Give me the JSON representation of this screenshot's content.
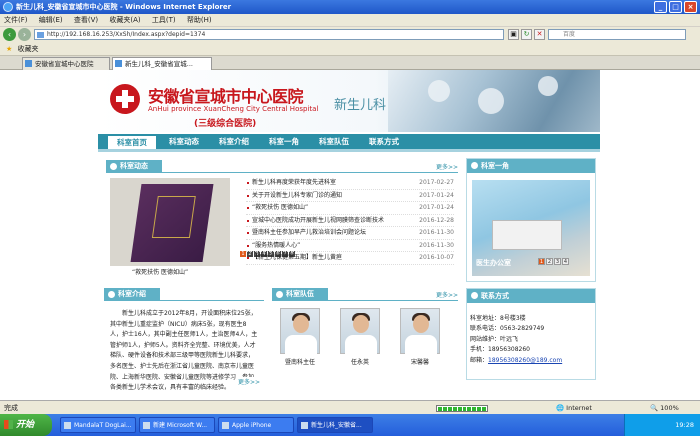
{
  "window": {
    "title": "新生儿科_安徽省宣城市中心医院 - Windows Internet Explorer",
    "min": "_",
    "max": "□",
    "close": "×"
  },
  "menu": [
    "文件(F)",
    "编辑(E)",
    "查看(V)",
    "收藏夹(A)",
    "工具(T)",
    "帮助(H)"
  ],
  "address": {
    "url": "http://192.168.16.253/XxSh/Index.aspx?depid=1374",
    "search_placeholder": "百度"
  },
  "favorites": {
    "label": "收藏夹"
  },
  "tabs": [
    "安徽省宣城中心医院",
    "新生儿科_安徽省宣城..."
  ],
  "header": {
    "hospital_cn": "安徽省宣城市中心医院",
    "hospital_en": "AnHui province XuanCheng City Central Hospital",
    "level": "(三级综合医院)",
    "dept": "新生儿科"
  },
  "nav": [
    "科室首页",
    "科室动态",
    "科室介绍",
    "科室一角",
    "科室队伍",
    "联系方式"
  ],
  "news": {
    "title": "科室动态",
    "more": "更多>>",
    "caption": "“救死扶伤 医德如山”",
    "dots": [
      "1",
      "2",
      "3",
      "4",
      "5",
      "6",
      "7",
      "8"
    ],
    "items": [
      {
        "text": "新生儿科再度荣获年度先进科室",
        "date": "2017-02-27"
      },
      {
        "text": "关于开设新生儿科专家门诊的通知",
        "date": "2017-01-24"
      },
      {
        "text": "“救死扶伤 医德如山”",
        "date": "2017-01-24"
      },
      {
        "text": "宣城中心医院成功开展新生儿视网膜筛查诊断技术",
        "date": "2016-12-28"
      },
      {
        "text": "暨南科主任参加早产儿救治培训会问题论坛",
        "date": "2016-11-30"
      },
      {
        "text": "“服务热情暖人心”",
        "date": "2016-11-30"
      },
      {
        "text": "【新生儿保健第五期】新生儿黄疸",
        "date": "2016-10-07"
      }
    ]
  },
  "corner": {
    "title": "科室一角",
    "caption": "医生办公室",
    "dots": [
      "1",
      "2",
      "3",
      "4"
    ]
  },
  "intro": {
    "title": "科室介绍",
    "more": "更多>>",
    "text": "新生儿科成立于2012年8月，开设面积床位25张，其中新生儿重症监护（NICU）病床5张，现有医生8人，护士16人，其中副主任医师1人，主治医师4人，主管护师1人，护师5人。资料齐全完整、环境优美，人才梯队、硬件设备和技术部三级甲等医院新生儿科要求，多名医生、护士先后在浙江省儿童医院、南京市儿童医院、上海新华医院、安徽省儿童医院等进修学习，参加各类新生儿学术会议，具有丰富的临床经验。"
  },
  "team": {
    "title": "科室队伍",
    "more": "更多>>",
    "members": [
      "暨南科主任",
      "任永英",
      "宋馨馨"
    ]
  },
  "contact": {
    "title": "联系方式",
    "address": "科室地址：8号楼3楼",
    "phone": "联系电话：0563-2829749",
    "maintainer": "网站维护：叶远飞",
    "mobile": "手机：18956308260",
    "email_label": "邮箱：",
    "email": "18956308260@189.com"
  },
  "status": {
    "text": "完成",
    "zone": "Internet",
    "zoom": "100%"
  },
  "taskbar": {
    "start": "开始",
    "items": [
      "MandalaT DogLai...",
      "新建 Microsoft W...",
      "Apple iPhone",
      "新生儿科_安徽省..."
    ],
    "clock": "19:28"
  }
}
